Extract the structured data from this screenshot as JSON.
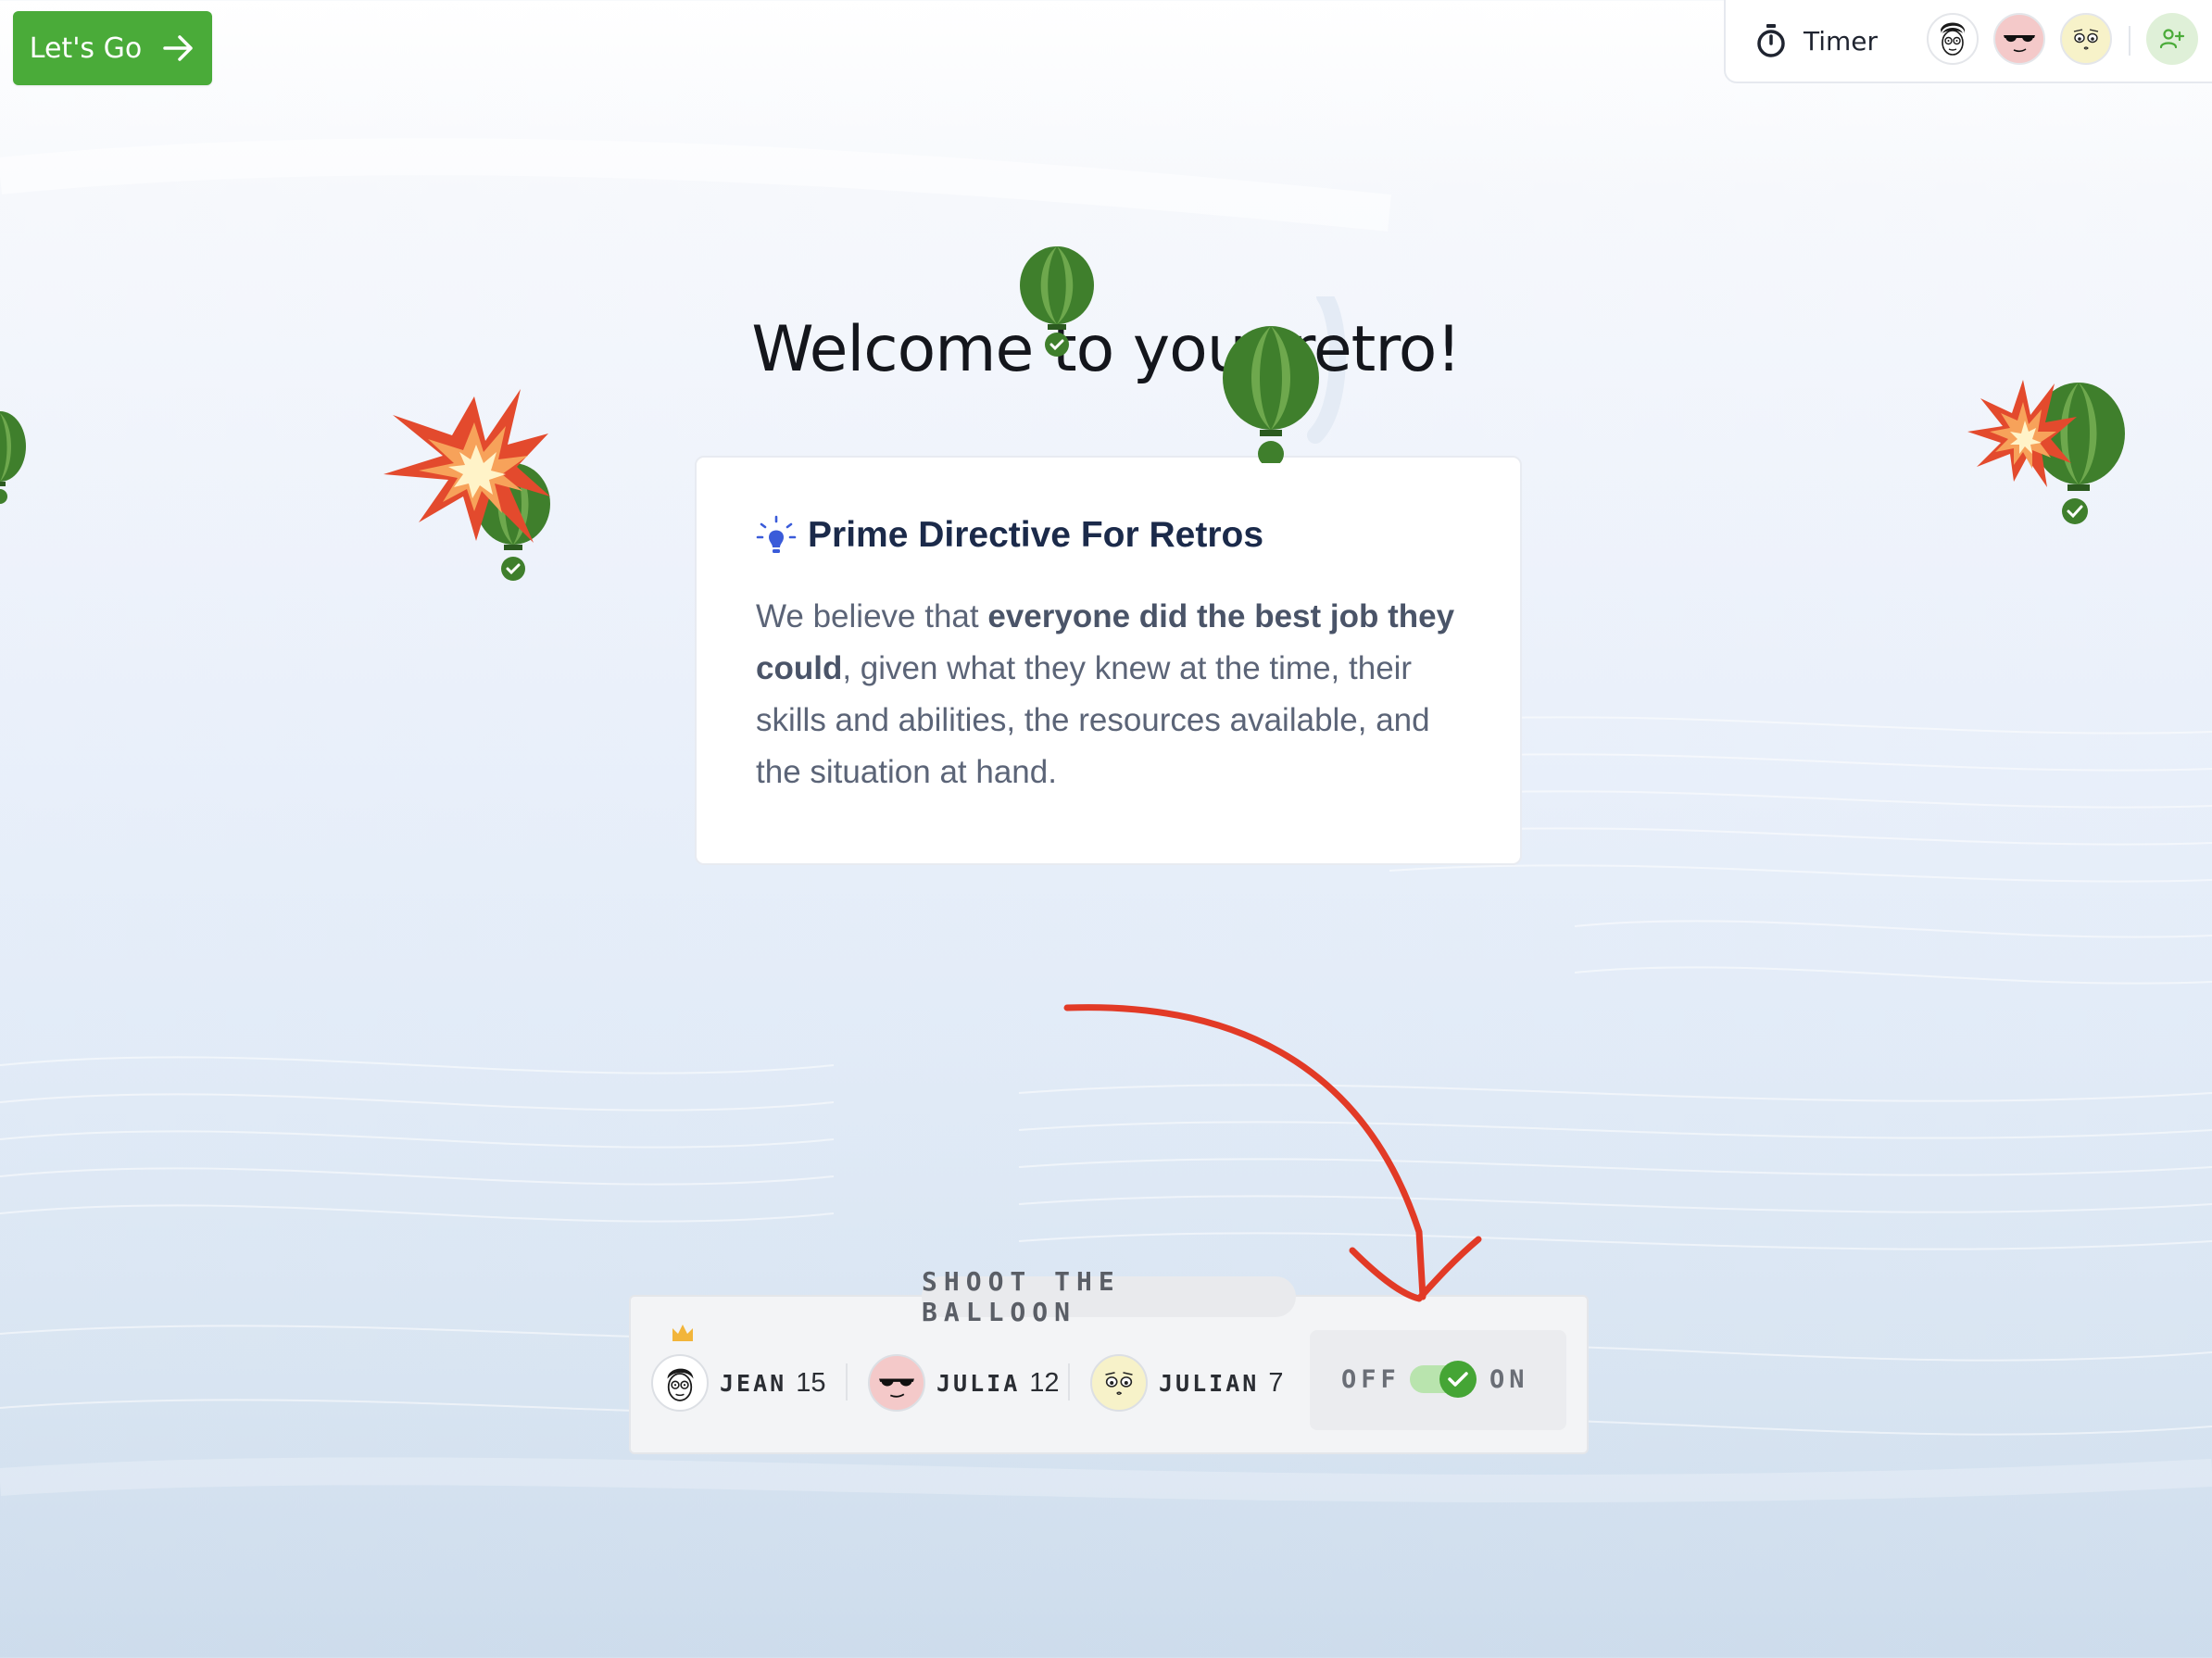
{
  "header": {
    "lets_go_label": "Let's Go",
    "timer_label": "Timer"
  },
  "main": {
    "title": "Welcome to your retro!",
    "card": {
      "title": "Prime Directive For Retros",
      "text_before": "We believe that ",
      "text_bold": "everyone did the best job they could",
      "text_after": ", given what they knew at the time, their skills and abilities, the resources available, and the situation at hand."
    }
  },
  "game": {
    "label": "SHOOT THE BALLOON",
    "players": [
      {
        "name": "JEAN",
        "score": "15",
        "avatar": "glasses-face-avatar",
        "leader": true
      },
      {
        "name": "JULIA",
        "score": "12",
        "avatar": "sunglasses-face-avatar",
        "leader": false
      },
      {
        "name": "JULIAN",
        "score": "7",
        "avatar": "worried-face-avatar",
        "leader": false
      }
    ],
    "toggle": {
      "off_label": "OFF",
      "on_label": "ON",
      "state": "on"
    }
  },
  "colors": {
    "accent_green": "#4aab39",
    "balloon_green": "#3f7f2c",
    "arrow_red": "#e23a26",
    "title_navy": "#1b2a4a"
  }
}
